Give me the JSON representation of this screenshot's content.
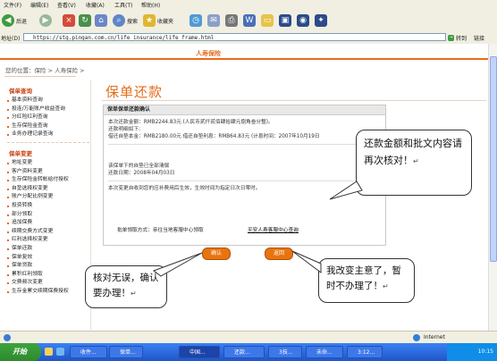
{
  "menu": [
    "文件(F)",
    "编辑(E)",
    "查看(V)",
    "收藏(A)",
    "工具(T)",
    "帮助(H)"
  ],
  "toolbar": {
    "back": "后退",
    "search": "搜索",
    "favorites": "收藏夹"
  },
  "address": {
    "label": "地址(D)",
    "url": "https://stg.pingan.com.cn/life_insurance/life_frame.html",
    "go": "转到",
    "links": "链接"
  },
  "header": {
    "tab": "人寿保险"
  },
  "breadcrumb": "您的位置：保险 > 人寿保险 >",
  "sidebar": {
    "section1": "保单查询",
    "items1": [
      "基本资料查询",
      "投连/万能账户收益查询",
      "分红险红利查询",
      "生存保险金查询",
      "业务办理记录查询"
    ],
    "section2": "保单变更",
    "items2": [
      "地址变更",
      "客户资料变更",
      "生存保险金转帐给付授权",
      "自垫选择权变更",
      "账户分配比例变更",
      "投资转换",
      "部分领取",
      "追加保费",
      "续期交费方式变更",
      "红利选择权变更",
      "保单还款",
      "保单复效",
      "保单贷款",
      "累积红利领取",
      "交费频次变更",
      "生存金累交续期保费授权"
    ]
  },
  "page": {
    "title": "保单还款",
    "box_title": "保单保单还款确认",
    "lines1": [
      "本次还款金额：RMB2244.83元 (人民币贰仟贰佰肆拾肆元捌角叁分整)。",
      "还款明细如下:",
      "借还自垫本金：RMB2180.00元    借还自垫利息：RMB64.83元 (计息时间：2007年10月19日"
    ],
    "lines2": [
      "该保单下的自垫已全部清偿",
      "还款日期：2008年04月03日"
    ],
    "lines3": [
      "本次变更自收到您的应补费用后生效，生效时间为指定日次日零时。"
    ],
    "foot_label": "批单领取方式：亲往当地客服中心领取",
    "foot_link": "平安人寿客服中心查询",
    "confirm": "确认",
    "back": "返回"
  },
  "bubbles": {
    "top": "还款金额和批文内容请再次核对！",
    "left": "核对无误，确认要办理！",
    "right": "我改变主意了，暂时不办理了！",
    "pilcrow": "↵"
  },
  "status": {
    "zone": "Internet"
  },
  "taskbar": {
    "start": "开始",
    "tasks": [
      "收件...",
      "保单...",
      "中国...",
      "还款...",
      "3技...",
      "未命...",
      "3:12..."
    ],
    "time": "10:15"
  },
  "colors": {
    "accent": "#e46d1c",
    "button": "#e8740f",
    "taskbar": "#245edb",
    "start": "#3c9b3c"
  }
}
